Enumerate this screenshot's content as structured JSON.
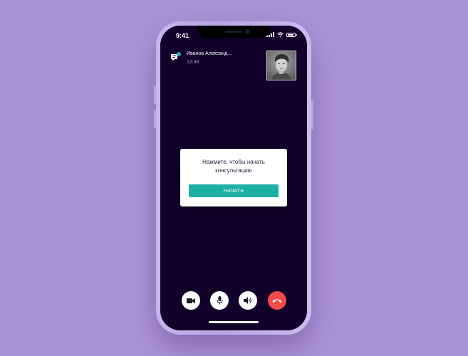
{
  "status_bar": {
    "time": "9:41"
  },
  "caller": {
    "name": "Иванов Александ...",
    "time": "12:48"
  },
  "prompt": {
    "message": "Нажмите, чтобы начать консультацию",
    "button_label": "НАЧАТЬ"
  },
  "controls": [
    {
      "icon": "video-camera-icon"
    },
    {
      "icon": "microphone-icon"
    },
    {
      "icon": "speaker-icon"
    },
    {
      "icon": "end-call-icon"
    }
  ],
  "colors": {
    "background": "#ab94d6",
    "video_bg": "#12002b",
    "accent": "#1db0a5",
    "end_call": "#f04a4a"
  }
}
